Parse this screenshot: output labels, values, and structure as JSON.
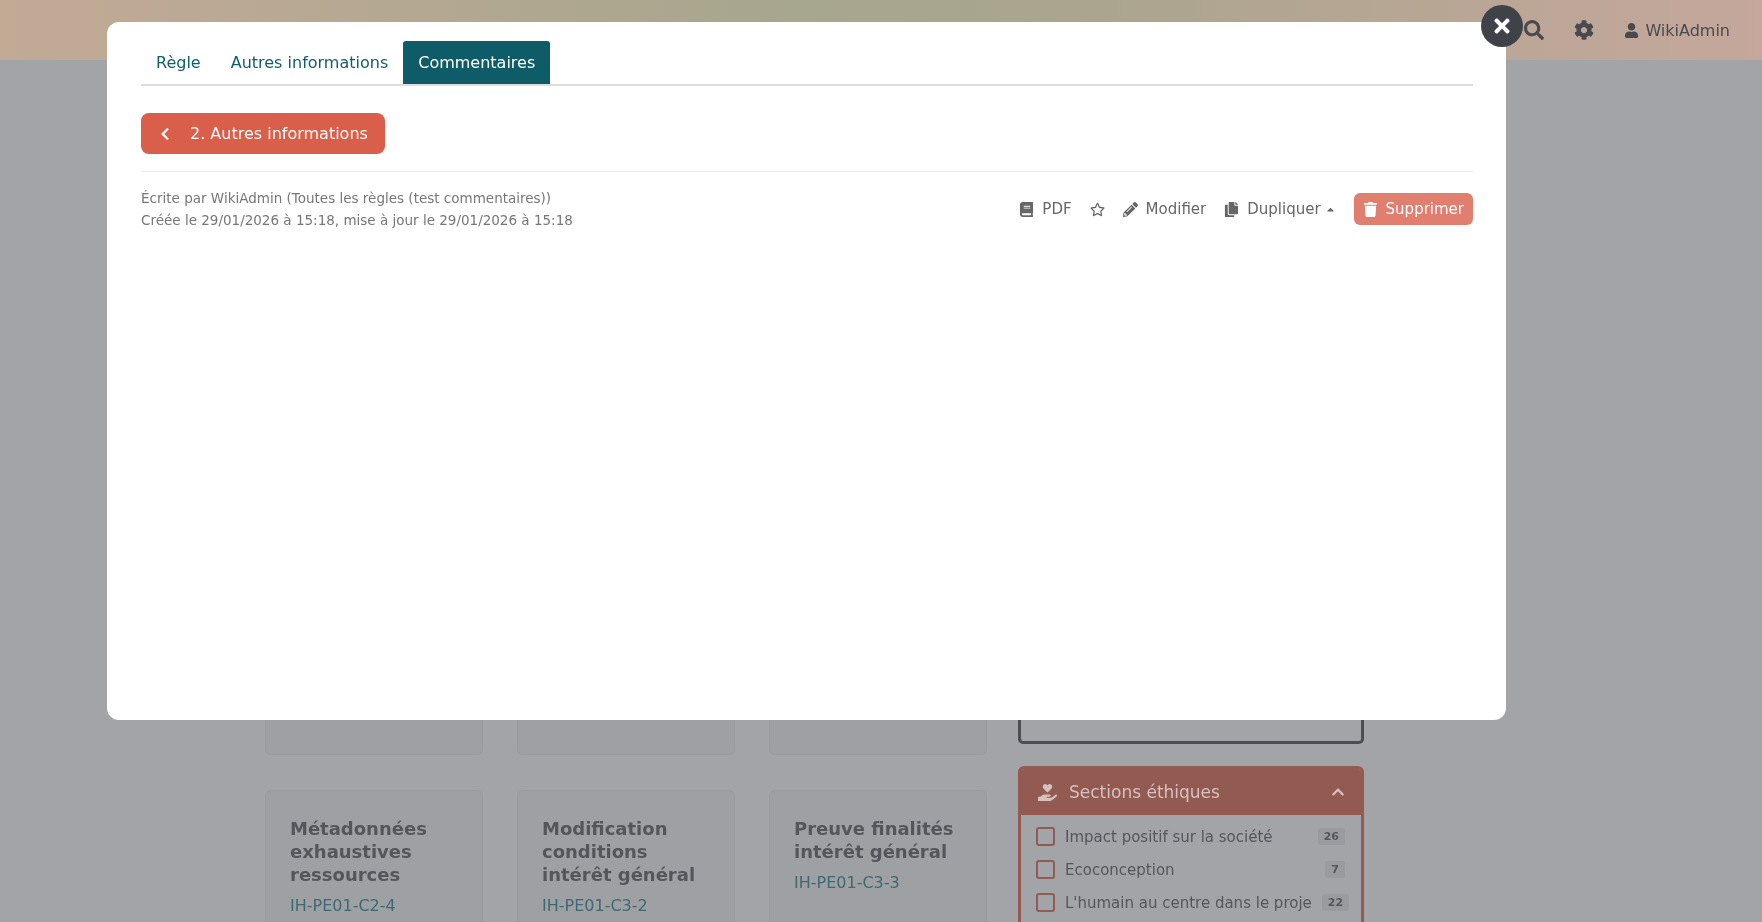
{
  "navbar": {
    "user": "WikiAdmin"
  },
  "cards": [
    {
      "title": "Métadonnées exhaustives ressources",
      "code": "IH-PE01-C2-4"
    },
    {
      "title": "Modification conditions intérêt général",
      "code": "IH-PE01-C3-2"
    },
    {
      "title": "Preuve finalités intérêt général",
      "code": "IH-PE01-C3-3"
    }
  ],
  "filter_panel": {
    "title": "Sections éthiques",
    "expanded": true,
    "items": [
      {
        "label": "Impact positif sur la société",
        "count": "26",
        "checked": false
      },
      {
        "label": "Ecoconception",
        "count": "7",
        "checked": false
      },
      {
        "label": "L'humain au centre dans le proje",
        "count": "22",
        "checked": false
      }
    ]
  },
  "modal": {
    "tabs": [
      {
        "label": "Règle",
        "selected": false
      },
      {
        "label": "Autres informations",
        "selected": false
      },
      {
        "label": "Commentaires",
        "selected": true
      }
    ],
    "back_button": "2. Autres informations",
    "meta": [
      "Écrite par WikiAdmin (Toutes les règles (test commentaires))",
      "Créée le 29/01/2026 à 15:18, mise à jour le 29/01/2026 à 15:18"
    ],
    "actions": [
      {
        "kind": "pdf",
        "label": "PDF"
      },
      {
        "kind": "favorite"
      },
      {
        "kind": "edit",
        "label": "Modifier"
      },
      {
        "kind": "duplicate",
        "label": "Dupliquer"
      },
      {
        "kind": "delete",
        "label": "Supprimer"
      }
    ]
  }
}
